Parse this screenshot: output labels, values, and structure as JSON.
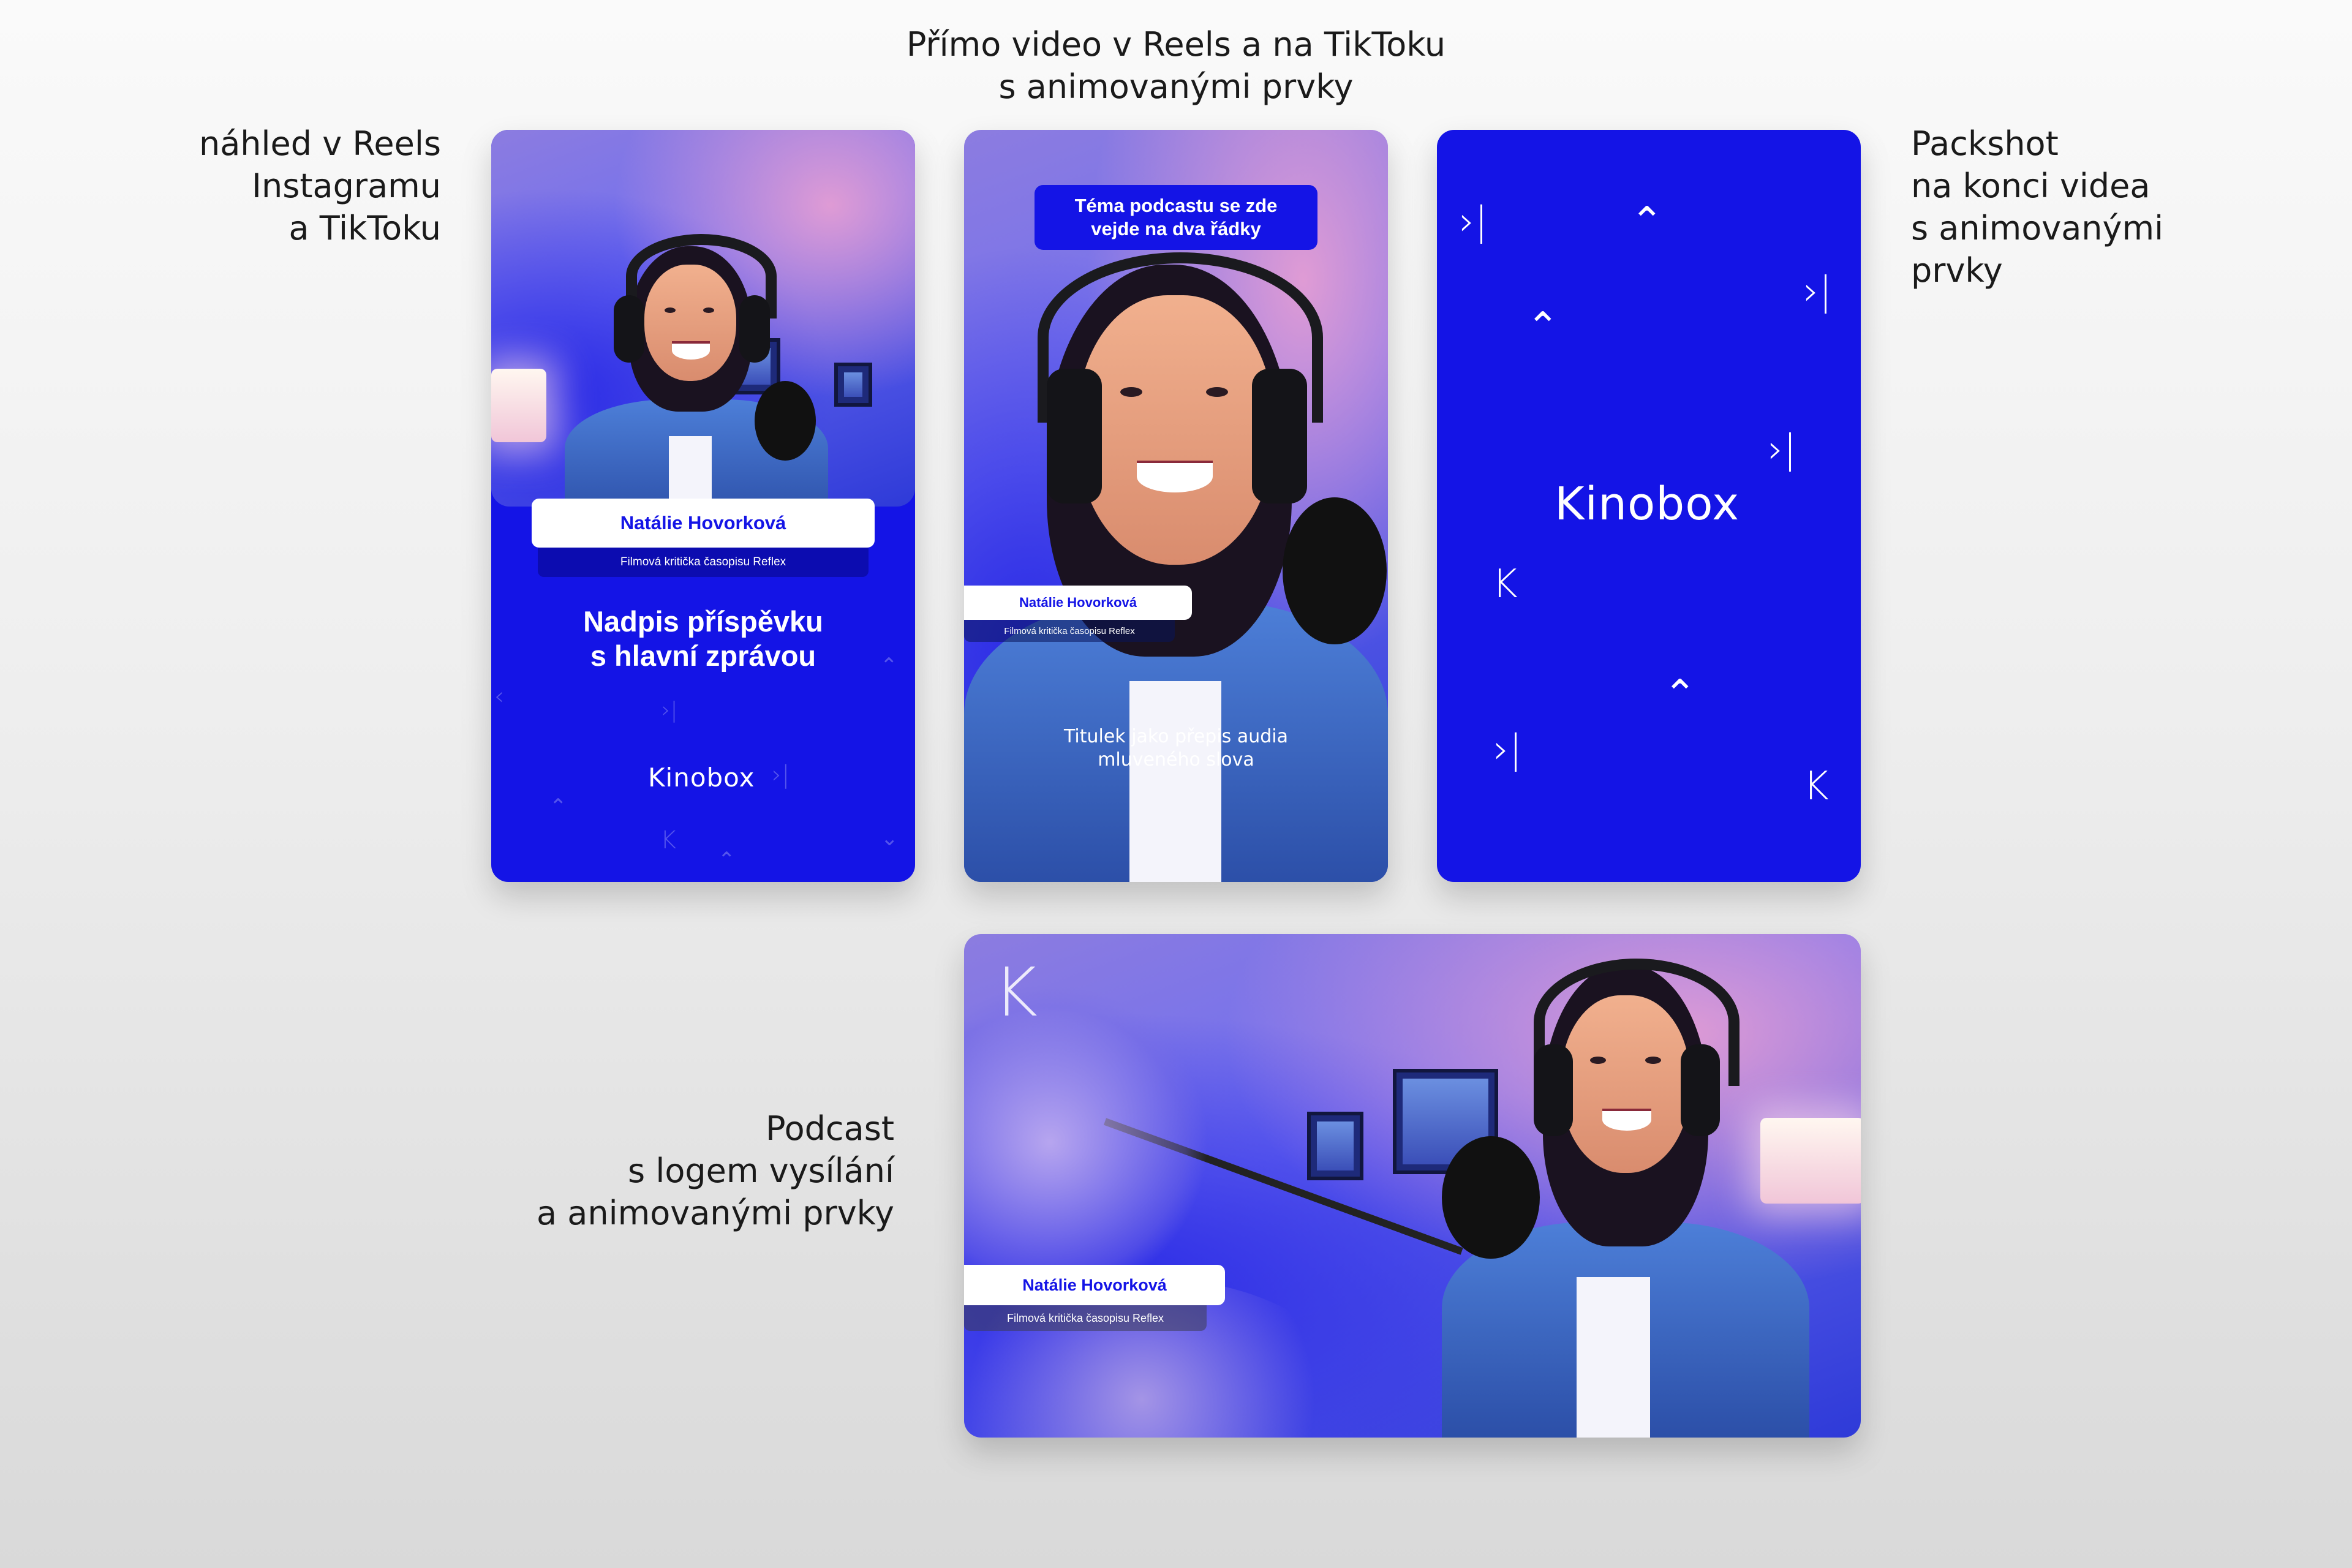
{
  "captions": {
    "top": [
      "Přímo video v Reels a na TikToku",
      "s animovanými prvky"
    ],
    "left": [
      "náhled v Reels",
      "Instagramu",
      "a TikToku"
    ],
    "right": [
      "Packshot",
      "na konci videa",
      "s animovanými",
      "prvky"
    ],
    "podcast": [
      "Podcast",
      "s logem vysílání",
      "a animovanými prvky"
    ]
  },
  "card_preview": {
    "name": "Natálie Hovorková",
    "role": "Filmová kritička časopisu Reflex",
    "headline": [
      "Nadpis příspěvku",
      "s hlavní zprávou"
    ],
    "logo": "Kinobox"
  },
  "card_video": {
    "topic": [
      "Téma podcastu se zde",
      "vejde na dva řádky"
    ],
    "name": "Natálie Hovorková",
    "role": "Filmová kritička časopisu Reflex",
    "subtitle": [
      "Titulek jako přepis audia",
      "mluveného slova"
    ]
  },
  "card_packshot": {
    "logo": "Kinobox"
  },
  "card_podcast": {
    "name": "Natálie Hovorková",
    "role": "Filmová kritička časopisu Reflex"
  },
  "colors": {
    "brand_blue": "#1414e6",
    "white": "#ffffff"
  },
  "icons": [
    "skip-forward-icon",
    "chevron-up-bar-icon",
    "k-logo-icon"
  ]
}
